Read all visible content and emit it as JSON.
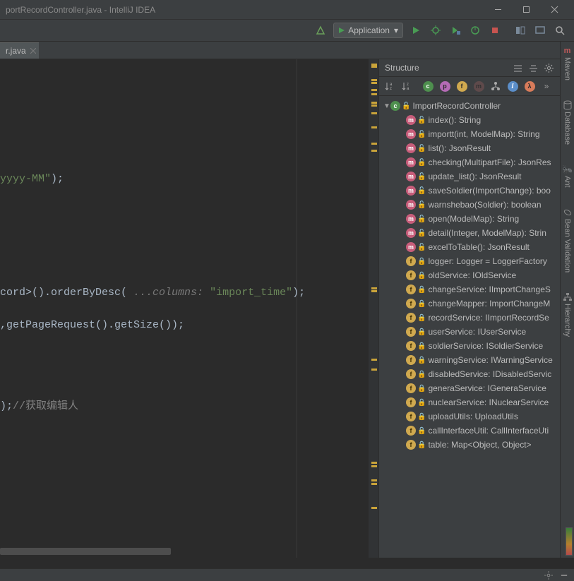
{
  "window": {
    "title": "portRecordController.java - IntelliJ IDEA"
  },
  "run": {
    "config": "Application"
  },
  "tab": {
    "file": "r.java"
  },
  "structure": {
    "title": "Structure",
    "class": "ImportRecordController",
    "methods": [
      "index(): String",
      "importt(int, ModelMap): String",
      "list(): JsonResult",
      "checking(MultipartFile): JsonRes",
      "update_list(): JsonResult",
      "saveSoldier(ImportChange): boo",
      "warnshebao(Soldier): boolean",
      "open(ModelMap): String",
      "detail(Integer, ModelMap): Strin",
      "excelToTable(): JsonResult"
    ],
    "fields": [
      "logger: Logger = LoggerFactory",
      "oldService: IOldService",
      "changeService: IImportChangeS",
      "changeMapper: ImportChangeM",
      "recordService: IImportRecordSe",
      "userService: IUserService",
      "soldierService: ISoldierService",
      "warningService: IWarningService",
      "disabledService: IDisabledServic",
      "generaService: IGeneraService",
      "nuclearService: INuclearService",
      "uploadUtils: UploadUtils",
      "callInterfaceUtil: CallInterfaceUti"
    ],
    "staticField": "table: Map<Object, Object>"
  },
  "code": {
    "l1a": "yyyy-MM\"",
    "l1b": ");",
    "l2a": "cord>().orderByDesc( ",
    "l2hint": "...columns: ",
    "l2b": "\"import_time\"",
    "l2c": ");",
    "l3a": ",getPageRequest().getSize());",
    "l4a": ");",
    "l4cmt": "//获取编辑人"
  },
  "side": {
    "labels": [
      "Maven",
      "Database",
      "Ant",
      "Bean Validation",
      "Hierarchy"
    ]
  }
}
